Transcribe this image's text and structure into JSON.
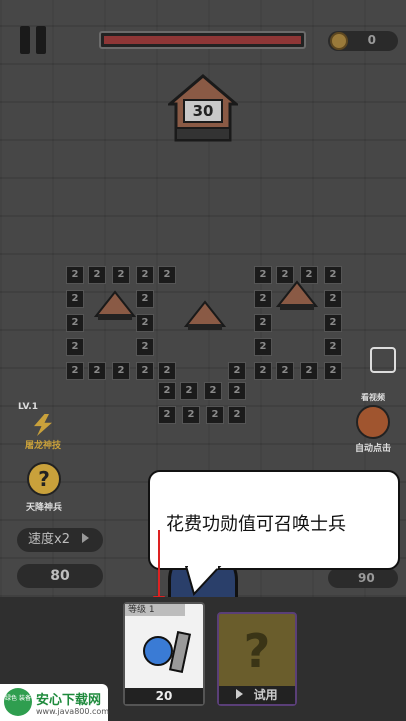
{
  "hud": {
    "coin_value": "0",
    "enemy_base_level": "30"
  },
  "fort_tile_label": "2",
  "left_panel": {
    "lv_label": "LV.1",
    "skill_label": "屠龙神技",
    "gift_label": "天降神兵",
    "speed_label": "速度x2",
    "troops": "80"
  },
  "right_panel": {
    "autoclick_top": "看视频",
    "autoclick_label": "自动点击",
    "count": "90"
  },
  "bubble": {
    "text": "花费功勋值可召唤士兵"
  },
  "card": {
    "level_tag": "等级 1",
    "cost": "20"
  },
  "trial_card": {
    "label": "试用",
    "question": "?"
  },
  "watermark": {
    "name": "安心下载网",
    "url": "www.java800.com",
    "logo_text": "绿色 装备"
  },
  "colors": {
    "bg": "#474747",
    "hp_fill": "#8e3636",
    "accent_gold": "#c9a13b"
  }
}
